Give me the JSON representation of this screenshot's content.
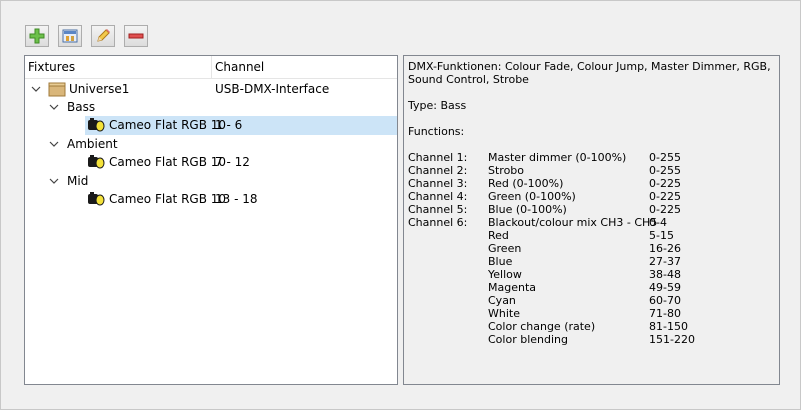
{
  "toolbar": {
    "add": "add-icon",
    "properties": "properties-icon",
    "edit": "edit-icon",
    "remove": "remove-icon"
  },
  "tree": {
    "headers": {
      "fixtures": "Fixtures",
      "channel": "Channel"
    },
    "universe": {
      "label": "Universe1",
      "channel": "USB-DMX-Interface"
    },
    "groups": [
      {
        "label": "Bass",
        "fixture": "Cameo Flat RGB 10",
        "channel": "1 - 6"
      },
      {
        "label": "Ambient",
        "fixture": "Cameo Flat RGB 10",
        "channel": "7 - 12"
      },
      {
        "label": "Mid",
        "fixture": "Cameo Flat RGB 10",
        "channel": "13 - 18"
      }
    ]
  },
  "info": {
    "dmx_functions": "DMX-Funktionen: Colour Fade, Colour Jump, Master Dimmer, RGB, Sound Control, Strobe",
    "type": "Type: Bass",
    "functions_heading": "Functions:",
    "channels": [
      [
        "Channel 1:",
        "Master dimmer (0-100%)",
        "0-255"
      ],
      [
        "Channel 2:",
        "Strobo",
        "0-255"
      ],
      [
        "Channel 3:",
        "Red (0-100%)",
        "0-225"
      ],
      [
        "Channel 4:",
        "Green (0-100%)",
        "0-225"
      ],
      [
        "Channel 5:",
        "Blue (0-100%)",
        "0-225"
      ],
      [
        "Channel 6:",
        "Blackout/colour mix CH3 - CH5",
        "0-4"
      ],
      [
        "",
        "Red",
        "5-15"
      ],
      [
        "",
        "Green",
        "16-26"
      ],
      [
        "",
        "Blue",
        "27-37"
      ],
      [
        "",
        "Yellow",
        "38-48"
      ],
      [
        "",
        "Magenta",
        "49-59"
      ],
      [
        "",
        "Cyan",
        "60-70"
      ],
      [
        "",
        "White",
        "71-80"
      ],
      [
        "",
        "Color change (rate)",
        "81-150"
      ],
      [
        "",
        "Color blending",
        "151-220"
      ]
    ]
  }
}
